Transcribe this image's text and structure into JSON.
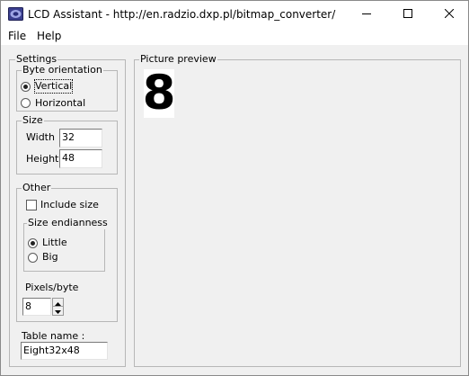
{
  "window": {
    "title": "LCD Assistant -  http://en.radzio.dxp.pl/bitmap_converter/"
  },
  "menu": {
    "file": "File",
    "help": "Help"
  },
  "settings": {
    "title": "Settings",
    "byte_orientation": {
      "title": "Byte orientation",
      "options": [
        {
          "label": "Vertical",
          "checked": true
        },
        {
          "label": "Horizontal",
          "checked": false
        }
      ]
    },
    "size": {
      "title": "Size",
      "width_label": "Width",
      "width_value": "32",
      "height_label": "Height",
      "height_value": "48"
    },
    "other": {
      "title": "Other",
      "include_size_label": "Include size",
      "include_size_checked": false,
      "endianness": {
        "title": "Size endianness",
        "options": [
          {
            "label": "Little",
            "checked": true
          },
          {
            "label": "Big",
            "checked": false
          }
        ]
      },
      "pixels_per_byte_label": "Pixels/byte",
      "pixels_per_byte_value": "8"
    },
    "table_name_label": "Table name :",
    "table_name_value": "Eight32x48"
  },
  "preview": {
    "title": "Picture preview",
    "glyph": "8"
  }
}
